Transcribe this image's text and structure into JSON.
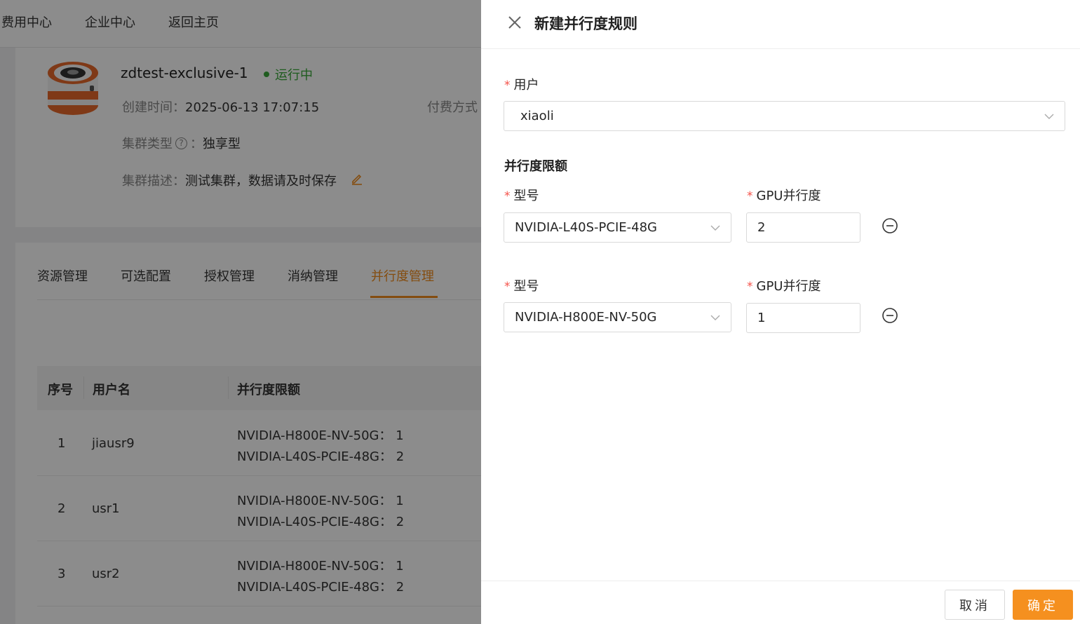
{
  "nav": {
    "items": [
      "费用中心",
      "企业中心",
      "返回主页"
    ]
  },
  "cluster": {
    "name": "zdtest-exclusive-1",
    "status": "运行中",
    "created_label": "创建时间：",
    "created_value": "2025-06-13 17:07:15",
    "pay_label": "付费方式",
    "type_label": "集群类型",
    "type_sep": "：",
    "type_value": "独享型",
    "desc_label": "集群描述：",
    "desc_value": "测试集群，数据请及时保存"
  },
  "tabs": [
    "资源管理",
    "可选配置",
    "授权管理",
    "消纳管理",
    "并行度管理"
  ],
  "active_tab": "并行度管理",
  "table": {
    "headers": [
      "序号",
      "用户名",
      "并行度限额"
    ],
    "rows": [
      {
        "index": "1",
        "user": "jiausr9",
        "lines": [
          "NVIDIA-H800E-NV-50G： 1",
          "NVIDIA-L40S-PCIE-48G： 2"
        ]
      },
      {
        "index": "2",
        "user": "usr1",
        "lines": [
          "NVIDIA-H800E-NV-50G： 1",
          "NVIDIA-L40S-PCIE-48G： 2"
        ]
      },
      {
        "index": "3",
        "user": "usr2",
        "lines": [
          "NVIDIA-H800E-NV-50G： 1",
          "NVIDIA-L40S-PCIE-48G： 2"
        ]
      }
    ]
  },
  "drawer": {
    "title": "新建并行度规则",
    "user_label": "用户",
    "user_value": "xiaoli",
    "section_title": "并行度限额",
    "model_label": "型号",
    "gpu_label": "GPU并行度",
    "rules": [
      {
        "model": "NVIDIA-L40S-PCIE-48G",
        "gpu": "2"
      },
      {
        "model": "NVIDIA-H800E-NV-50G",
        "gpu": "1"
      }
    ],
    "cancel_label": "取消",
    "ok_label": "确定"
  },
  "colors": {
    "accent": "#f08c1e",
    "primary_button": "#f5901f",
    "status": "#3aa83a",
    "required": "#f5524a"
  }
}
